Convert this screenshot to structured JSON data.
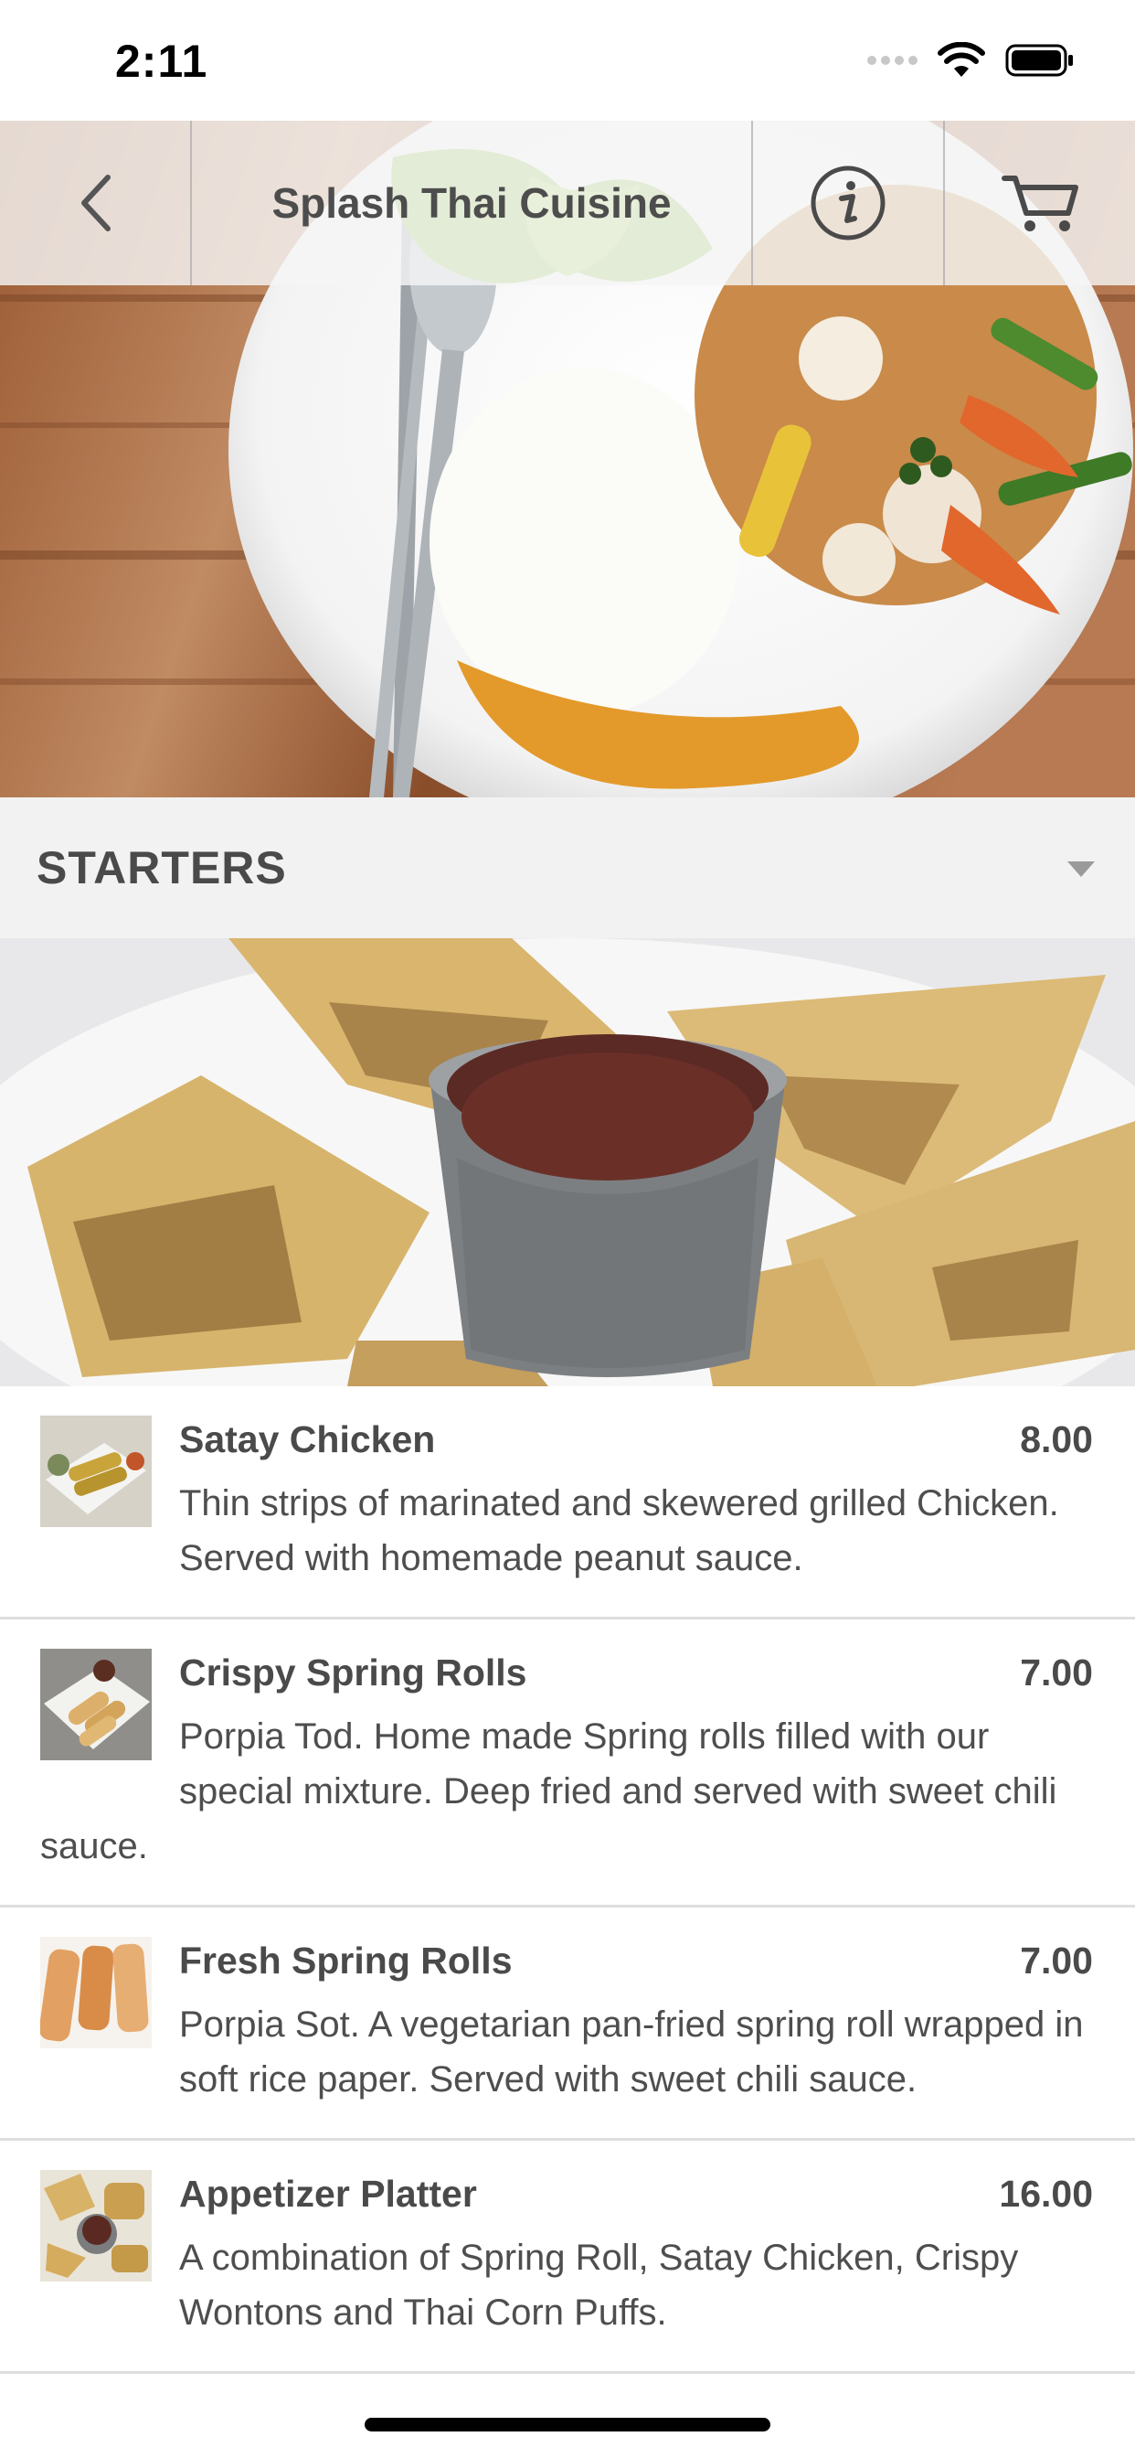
{
  "status_bar": {
    "time": "2:11"
  },
  "nav": {
    "back_icon": "chevron-left-icon",
    "title": "Splash Thai Cuisine",
    "info_icon": "info-icon",
    "cart_icon": "cart-icon"
  },
  "category": {
    "title": "STARTERS",
    "toggle_icon": "caret-down-icon"
  },
  "menu_items": [
    {
      "name": "Satay Chicken",
      "price": "8.00",
      "description": "Thin strips of marinated and skewered grilled Chicken. Served with homemade peanut sauce."
    },
    {
      "name": "Crispy Spring Rolls",
      "price": "7.00",
      "description": "Porpia Tod. Home made Spring rolls filled with our special mixture. Deep fried and served with sweet chili sauce."
    },
    {
      "name": "Fresh Spring Rolls",
      "price": "7.00",
      "description": "Porpia Sot. A vegetarian pan-fried spring roll wrapped in soft rice paper. Served with sweet chili sauce."
    },
    {
      "name": "Appetizer Platter",
      "price": "16.00",
      "description": "A combination of Spring Roll, Satay Chicken, Crispy Wontons and Thai Corn Puffs."
    }
  ]
}
